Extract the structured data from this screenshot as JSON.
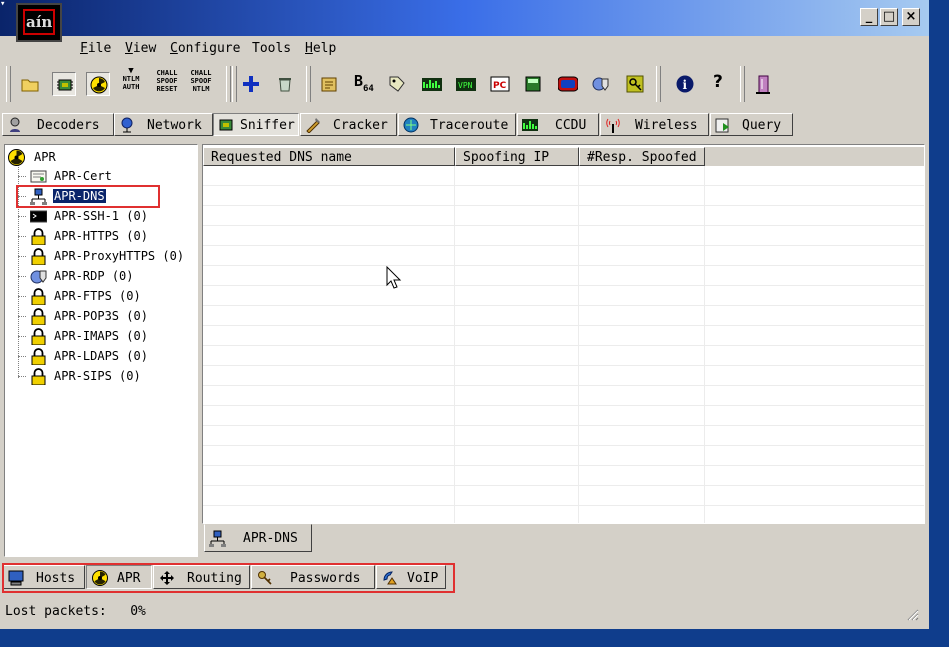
{
  "app": {
    "icon_text": "aín",
    "sysmenu_glyph": "▾"
  },
  "window_buttons": {
    "minimize": "_",
    "maximize": "□",
    "close": "×"
  },
  "menu": [
    {
      "label": "File",
      "accel": "F",
      "rest": "ile"
    },
    {
      "label": "View",
      "accel": "V",
      "rest": "iew"
    },
    {
      "label": "Configure",
      "accel": "C",
      "rest": "onfigure"
    },
    {
      "label": "Tools",
      "accel": "",
      "rest": "Tools"
    },
    {
      "label": "Help",
      "accel": "H",
      "rest": "elp"
    }
  ],
  "toolbar": {
    "ntlm_auth": [
      "NTLM",
      "AUTH"
    ],
    "chall_spoof_reset": [
      "CHALL",
      "SPOOF",
      "RESET"
    ],
    "chall_spoof_ntlm": [
      "CHALL",
      "SPOOF",
      "NTLM"
    ],
    "b64_main": "B",
    "b64_sub": "64",
    "help_q": "?",
    "info_i": "i"
  },
  "top_tabs": [
    {
      "label": "Decoders",
      "icon": "decoders-icon"
    },
    {
      "label": "Network",
      "icon": "network-icon"
    },
    {
      "label": "Sniffer",
      "icon": "sniffer-icon"
    },
    {
      "label": "Cracker",
      "icon": "cracker-icon"
    },
    {
      "label": "Traceroute",
      "icon": "traceroute-icon"
    },
    {
      "label": "CCDU",
      "icon": "ccdu-icon"
    },
    {
      "label": "Wireless",
      "icon": "wireless-icon"
    },
    {
      "label": "Query",
      "icon": "query-icon"
    }
  ],
  "active_top_tab": "Sniffer",
  "tree": {
    "root": "APR",
    "children": [
      {
        "label": "APR-Cert",
        "count": "",
        "icon": "certificate-icon"
      },
      {
        "label": "APR-DNS",
        "count": "",
        "icon": "dns-icon",
        "selected": true
      },
      {
        "label": "APR-SSH-1",
        "count": "(0)",
        "icon": "terminal-icon"
      },
      {
        "label": "APR-HTTPS",
        "count": "(0)",
        "icon": "lock-icon"
      },
      {
        "label": "APR-ProxyHTTPS",
        "count": "(0)",
        "icon": "lock-icon"
      },
      {
        "label": "APR-RDP",
        "count": "(0)",
        "icon": "rdp-icon"
      },
      {
        "label": "APR-FTPS",
        "count": "(0)",
        "icon": "lock-icon"
      },
      {
        "label": "APR-POP3S",
        "count": "(0)",
        "icon": "lock-icon"
      },
      {
        "label": "APR-IMAPS",
        "count": "(0)",
        "icon": "lock-icon"
      },
      {
        "label": "APR-LDAPS",
        "count": "(0)",
        "icon": "lock-icon"
      },
      {
        "label": "APR-SIPS",
        "count": "(0)",
        "icon": "lock-icon"
      }
    ]
  },
  "table": {
    "columns": [
      "Requested DNS name",
      "Spoofing IP",
      "#Resp. Spoofed"
    ],
    "rows": []
  },
  "sub_tab": {
    "label": "APR-DNS"
  },
  "bottom_tabs": [
    {
      "label": "Hosts",
      "icon": "hosts-icon"
    },
    {
      "label": "APR",
      "icon": "radiation-icon"
    },
    {
      "label": "Routing",
      "icon": "routing-icon"
    },
    {
      "label": "Passwords",
      "icon": "keys-icon"
    },
    {
      "label": "VoIP",
      "icon": "voip-icon"
    }
  ],
  "active_bottom_tab": "APR",
  "status": {
    "label": "Lost packets:",
    "value": "0%"
  },
  "colors": {
    "titlebar_start": "#0a246a",
    "titlebar_end": "#a6caf0",
    "selection": "#0a246a",
    "highlight_box": "#e03030",
    "desktop": "#0f3d8c"
  }
}
